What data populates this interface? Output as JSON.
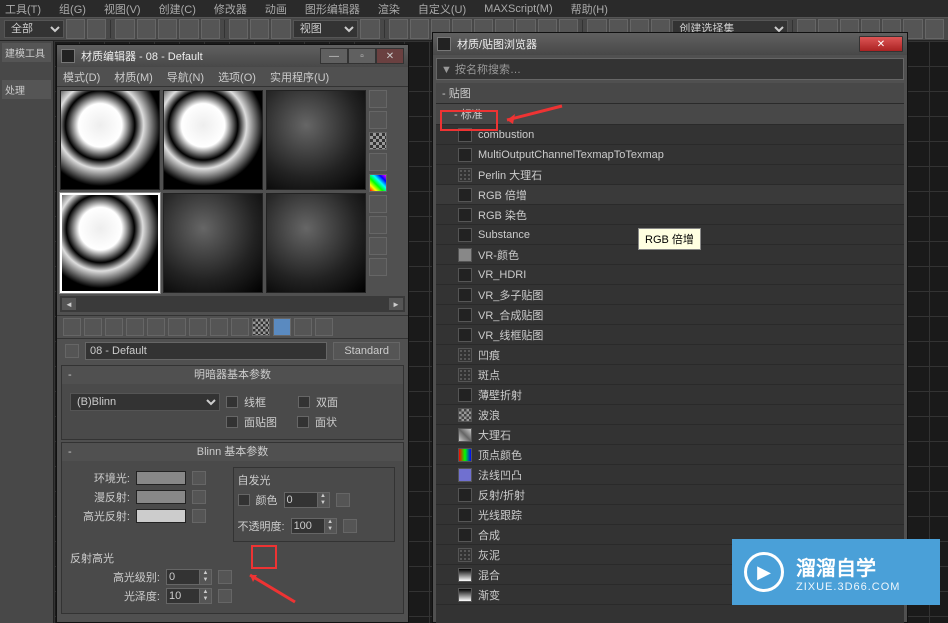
{
  "top_menu": {
    "items": [
      "工具(T)",
      "组(G)",
      "视图(V)",
      "创建(C)",
      "修改器",
      "动画",
      "图形编辑器",
      "渲染",
      "自定义(U)",
      "MAXScript(M)",
      "帮助(H)"
    ]
  },
  "toolbar": {
    "select_all": "全部",
    "view_label": "视图",
    "create_select_set": "创建选择集"
  },
  "left_tools": {
    "items": [
      "建模工具",
      "处理"
    ]
  },
  "material_editor": {
    "title": "材质编辑器 - 08 - Default",
    "menus": [
      "模式(D)",
      "材质(M)",
      "导航(N)",
      "选项(O)",
      "实用程序(U)"
    ],
    "name_field": "08 - Default",
    "type_button": "Standard",
    "rollout1": {
      "title": "明暗器基本参数",
      "shader": "(B)Blinn",
      "wire": "线框",
      "two_sided": "双面",
      "face_map": "面贴图",
      "faceted": "面状"
    },
    "rollout2": {
      "title": "Blinn 基本参数",
      "self_illum_group": "自发光",
      "ambient": "环境光:",
      "diffuse": "漫反射:",
      "specular": "高光反射:",
      "color_checkbox": "颜色",
      "color_val": "0",
      "opacity": "不透明度:",
      "opacity_val": "100",
      "spec_highlights": "反射高光",
      "spec_level": "高光级别:",
      "spec_level_val": "0",
      "glossiness": "光泽度:",
      "glossiness_val": "10"
    }
  },
  "map_browser": {
    "title": "材质/贴图浏览器",
    "search_placeholder": "▼ 按名称搜索…",
    "cat_maps": "- 贴图",
    "cat_standard": "- 标准",
    "tooltip": "RGB 倍增",
    "items": [
      "combustion",
      "MultiOutputChannelTexmapToTexmap",
      "Perlin 大理石",
      "RGB 倍增",
      "RGB 染色",
      "Substance",
      "VR-颜色",
      "VR_HDRI",
      "VR_多子贴图",
      "VR_合成贴图",
      "VR_线框贴图",
      "凹痕",
      "斑点",
      "薄壁折射",
      "波浪",
      "大理石",
      "顶点颜色",
      "法线凹凸",
      "反射/折射",
      "光线跟踪",
      "合成",
      "灰泥",
      "混合",
      "渐变"
    ]
  },
  "watermark": {
    "line1": "溜溜自学",
    "line2": "ZIXUE.3D66.COM"
  }
}
